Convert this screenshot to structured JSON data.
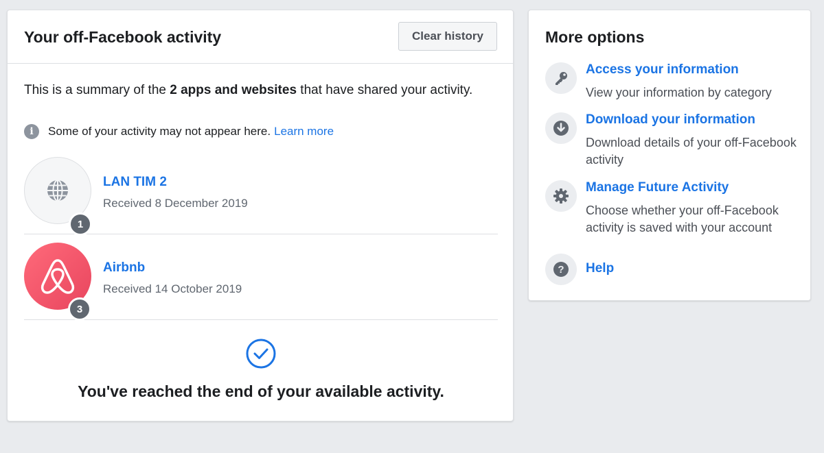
{
  "main": {
    "title": "Your off-Facebook activity",
    "clear_button": "Clear history",
    "summary_prefix": "This is a summary of the ",
    "summary_bold": "2 apps and websites",
    "summary_suffix": " that have shared your activity.",
    "notice_text": "Some of your activity may not appear here.",
    "learn_more": "Learn more",
    "activities": [
      {
        "name": "LAN TIM 2",
        "received": "Received 8 December 2019",
        "count": "1",
        "icon": "globe-icon"
      },
      {
        "name": "Airbnb",
        "received": "Received 14 October 2019",
        "count": "3",
        "icon": "airbnb-logo"
      }
    ],
    "end_message": "You've reached the end of your available activity."
  },
  "side": {
    "title": "More options",
    "options": [
      {
        "title": "Access your information",
        "description": "View your information by category",
        "icon": "key-icon"
      },
      {
        "title": "Download your information",
        "description": "Download details of your off-Facebook activity",
        "icon": "download-icon"
      },
      {
        "title": "Manage Future Activity",
        "description": "Choose whether your off-Facebook activity is saved with your account",
        "icon": "gear-icon"
      },
      {
        "title": "Help",
        "description": "",
        "icon": "help-icon"
      }
    ]
  },
  "colors": {
    "background": "#e9ebee",
    "link": "#1b74e4",
    "airbnb": "#ff5a5f",
    "badge": "#606770"
  }
}
